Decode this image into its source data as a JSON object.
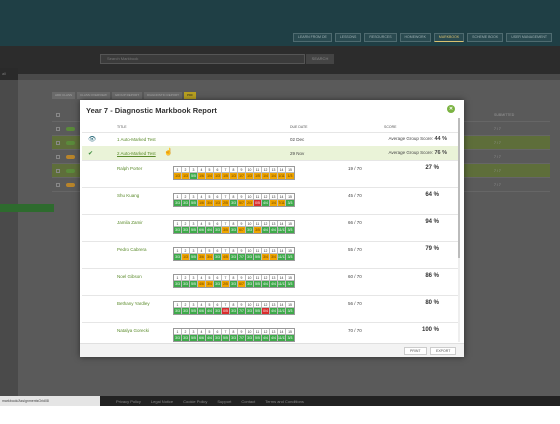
{
  "app": {
    "top_nav": [
      "LEARN FROM DE",
      "LESSONS",
      "RESOURCES",
      "HOMEWORK",
      "MARKBOOK",
      "SCHEME BOOK",
      "USER MANAGEMENT"
    ],
    "search_placeholder": "Search Markbook",
    "search_button": "SEARCH",
    "left_label": "all",
    "tabs": [
      "ADD CLASS",
      "CLASS OVERVIEW",
      "GROUP REPORT",
      "DIAGNOSTIC REPORT",
      "PDF"
    ],
    "submitted_header": "SUBMITTED",
    "submitted_values": [
      "7 / 7",
      "7 / 7",
      "7 / 7",
      "7 / 7",
      "7 / 7"
    ],
    "status_url": "markbook/AssignmentsGrid08",
    "footer_links": [
      "Privacy Policy",
      "Legal Notice",
      "Cookie Policy",
      "Support",
      "Contact",
      "Terms and Conditions"
    ]
  },
  "modal": {
    "title": "Year 7 - Diagnostic Markbook Report",
    "close_symbol": "✕",
    "headers": {
      "title": "TITLE",
      "due": "DUE DATE",
      "score": "SCORE"
    },
    "tests": [
      {
        "icon": "eye-icon",
        "glyph": "👁",
        "title": "1 Auto-Marked Test",
        "due": "02 Dec",
        "score_label": "Average Group Score:",
        "score_value": "44 %",
        "highlight": false
      },
      {
        "icon": "check-icon",
        "glyph": "✔",
        "title": "2 Auto-Marked Test",
        "due": "29 Nov",
        "score_label": "Average Group Score:",
        "score_value": "76 %",
        "highlight": true
      }
    ],
    "question_numbers": [
      "1",
      "2",
      "3",
      "4",
      "5",
      "6",
      "7",
      "8",
      "9",
      "10",
      "11",
      "12",
      "13",
      "14",
      "15"
    ],
    "students": [
      {
        "name": "Ralph Porter",
        "raw": "19 / 70",
        "pct": "27 %",
        "marks": [
          [
            "1/3",
            "o"
          ],
          [
            "1/3",
            "o"
          ],
          [
            "5/5",
            "g"
          ],
          [
            "1/6",
            "o"
          ],
          [
            "1/4",
            "o"
          ],
          [
            "1/3",
            "o"
          ],
          [
            "1/5",
            "o"
          ],
          [
            "1/3",
            "o"
          ],
          [
            "1/7",
            "o"
          ],
          [
            "1/3",
            "o"
          ],
          [
            "1/5",
            "o"
          ],
          [
            "1/4",
            "o"
          ],
          [
            "1/4",
            "o"
          ],
          [
            "1/11",
            "o"
          ],
          [
            "1/3",
            "o"
          ]
        ]
      },
      {
        "name": "Shu Kuang",
        "raw": "45 / 70",
        "pct": "64 %",
        "marks": [
          [
            "3/3",
            "g"
          ],
          [
            "3/3",
            "g"
          ],
          [
            "5/5",
            "g"
          ],
          [
            "1/6",
            "o"
          ],
          [
            "3/4",
            "o"
          ],
          [
            "1/3",
            "o"
          ],
          [
            "2/5",
            "o"
          ],
          [
            "3/3",
            "g"
          ],
          [
            "5/7",
            "o"
          ],
          [
            "2/3",
            "o"
          ],
          [
            "0/5",
            "r"
          ],
          [
            "4/4",
            "g"
          ],
          [
            "1/4",
            "o"
          ],
          [
            "7/11",
            "o"
          ],
          [
            "3/3",
            "g"
          ]
        ]
      },
      {
        "name": "Jamila Zamir",
        "raw": "66 / 70",
        "pct": "94 %",
        "marks": [
          [
            "3/3",
            "g"
          ],
          [
            "3/3",
            "g"
          ],
          [
            "5/5",
            "g"
          ],
          [
            "6/6",
            "g"
          ],
          [
            "4/4",
            "g"
          ],
          [
            "3/3",
            "g"
          ],
          [
            "3/5",
            "o"
          ],
          [
            "3/3",
            "g"
          ],
          [
            "6/7",
            "o"
          ],
          [
            "3/3",
            "g"
          ],
          [
            "3/5",
            "o"
          ],
          [
            "4/4",
            "g"
          ],
          [
            "4/4",
            "g"
          ],
          [
            "11/11",
            "g"
          ],
          [
            "3/3",
            "g"
          ]
        ]
      },
      {
        "name": "Pedro Cabrera",
        "raw": "55 / 70",
        "pct": "79 %",
        "marks": [
          [
            "3/3",
            "g"
          ],
          [
            "1/3",
            "o"
          ],
          [
            "5/5",
            "g"
          ],
          [
            "3/6",
            "o"
          ],
          [
            "3/4",
            "o"
          ],
          [
            "3/3",
            "g"
          ],
          [
            "4/5",
            "o"
          ],
          [
            "3/3",
            "g"
          ],
          [
            "7/7",
            "g"
          ],
          [
            "3/3",
            "g"
          ],
          [
            "5/5",
            "g"
          ],
          [
            "3/4",
            "o"
          ],
          [
            "3/4",
            "o"
          ],
          [
            "11/11",
            "g"
          ],
          [
            "3/3",
            "g"
          ]
        ]
      },
      {
        "name": "Noel Gibson",
        "raw": "60 / 70",
        "pct": "86 %",
        "marks": [
          [
            "3/3",
            "g"
          ],
          [
            "3/3",
            "g"
          ],
          [
            "5/5",
            "g"
          ],
          [
            "4/6",
            "o"
          ],
          [
            "3/4",
            "o"
          ],
          [
            "3/3",
            "g"
          ],
          [
            "2/5",
            "o"
          ],
          [
            "3/3",
            "g"
          ],
          [
            "6/7",
            "o"
          ],
          [
            "3/3",
            "g"
          ],
          [
            "5/5",
            "g"
          ],
          [
            "4/4",
            "g"
          ],
          [
            "4/4",
            "g"
          ],
          [
            "11/11",
            "g"
          ],
          [
            "3/3",
            "g"
          ]
        ]
      },
      {
        "name": "Bethany Yardley",
        "raw": "56 / 70",
        "pct": "80 %",
        "marks": [
          [
            "3/3",
            "g"
          ],
          [
            "3/3",
            "g"
          ],
          [
            "5/5",
            "g"
          ],
          [
            "6/6",
            "g"
          ],
          [
            "4/4",
            "g"
          ],
          [
            "3/3",
            "g"
          ],
          [
            "0/5",
            "r"
          ],
          [
            "3/3",
            "g"
          ],
          [
            "7/7",
            "g"
          ],
          [
            "3/3",
            "g"
          ],
          [
            "5/5",
            "g"
          ],
          [
            "0/4",
            "r"
          ],
          [
            "4/4",
            "g"
          ],
          [
            "11/11",
            "g"
          ],
          [
            "3/3",
            "g"
          ]
        ]
      },
      {
        "name": "Natalya Gorecki",
        "raw": "70 / 70",
        "pct": "100 %",
        "marks": [
          [
            "3/3",
            "g"
          ],
          [
            "3/3",
            "g"
          ],
          [
            "5/5",
            "g"
          ],
          [
            "6/6",
            "g"
          ],
          [
            "4/4",
            "g"
          ],
          [
            "3/3",
            "g"
          ],
          [
            "5/5",
            "g"
          ],
          [
            "3/3",
            "g"
          ],
          [
            "7/7",
            "g"
          ],
          [
            "3/3",
            "g"
          ],
          [
            "5/5",
            "g"
          ],
          [
            "4/4",
            "g"
          ],
          [
            "4/4",
            "g"
          ],
          [
            "11/11",
            "g"
          ],
          [
            "3/3",
            "g"
          ]
        ]
      }
    ],
    "buttons": {
      "print": "PRINT",
      "export": "EXPORT"
    }
  }
}
